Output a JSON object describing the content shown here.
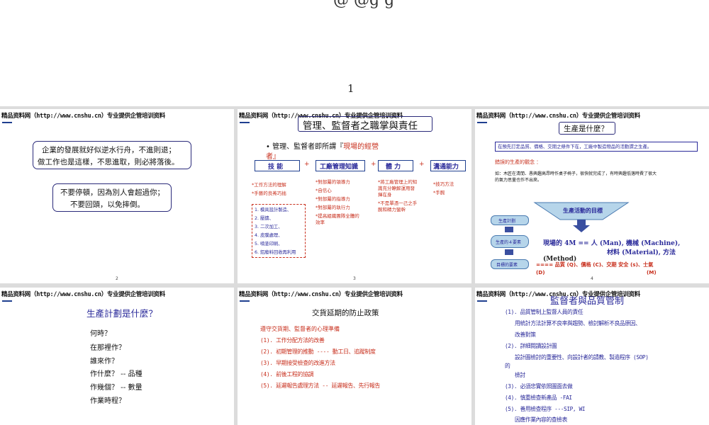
{
  "top_fragment": "@ @g g",
  "page_number": "1",
  "header_text": "精品资料网（http://www.cnshu.cn）专业提供企管培训资料",
  "slide1": {
    "box1": [
      "企業的發展就好似逆水行舟，不進則退；",
      "做工作也是這樣，不思進取，則必將落後。"
    ],
    "box2": [
      "不要停頓，因為別人會超過你；",
      "不要回頭，以免摔倒。"
    ],
    "num": "2"
  },
  "slide2": {
    "title": "管理、監督者之職掌與責任",
    "bullet_a": "• 管理、監督者即所謂『",
    "bullet_b": "現場的經營",
    "bullet_c": "者』",
    "headers": [
      "技 能",
      "+",
      "工廠管理知識",
      "+",
      "體 力",
      "+",
      "溝通能力"
    ],
    "col1_red": [
      "*工作方法的理解",
      "*手藝的良莠巧拙"
    ],
    "col1_list": [
      "1. 模具設計製造、",
      "2. 壓鑄、",
      "3. 二次加工、",
      "4. 皮膜處理、",
      "5. 噴塗印刷、",
      "6. 鋁廢料回收再利用"
    ],
    "col2": [
      "*對部屬的領導力",
      "*自信心",
      "*對部屬的指導力",
      "*對部屬的執行力",
      "*提高組織團隊全體的",
      "效率"
    ],
    "col3": [
      "*將工廠管理上的知",
      "識充分瞭解運用發",
      "揮在身",
      "*不是單憑一己之手",
      "腕和精力蠻幹"
    ],
    "col4": [
      "*技巧方法",
      "*手腕"
    ],
    "num": "3"
  },
  "slide3": {
    "title": "生產是什麼？",
    "definition": "在預先訂定品質、價格、交期之條件下在，工廠中製造物品的活動謂之生產。",
    "wrong_label": "錯誤的生產的觀念 ：",
    "example1": "如：木匠在清閒、愚興趣高昂時作桌子椅子，很快就完成了，有時興趣低落時費了很大",
    "example2": "的氣力思量也作不出來。",
    "funnel": "生產活動的目標",
    "steps": [
      "生產計劃",
      "生產的４要素",
      "目標的要素"
    ],
    "fourm_a": "現場的 4M   == 人 (Man), 機械 (Machine),",
    "fourm_b": "材料 (Material), 方法",
    "fourm_c": "(Method)",
    "qcd_a": "====  品質 (Q)、價格 (C)、交期 安全 (s)、士氣",
    "qcd_b1": "(D)",
    "qcd_b2": "(M)",
    "num": "4"
  },
  "slide4": {
    "title": "生產計劃是什麼？",
    "items": [
      "何時？",
      "在那裡作？",
      "誰來作？",
      "作什麼？ -- 品種",
      "作幾個？ -- 數量",
      "作業時程？"
    ]
  },
  "slide5": {
    "title": "交貨延期的防止政策",
    "subtitle": "遵守交貨期、監督者的心理準備",
    "items": [
      "(1). 工作分配方法的改善",
      "(2). 初期管理的推動  ----  動工日、追蹤制度",
      "(3). 早期接受檢查的改進方法",
      "(4). 前後工程的協調",
      "(5). 延遲報告處理方法  --  延遲報告、先行報告"
    ]
  },
  "slide6": {
    "title": "監督者與品質管制",
    "lines": [
      "(1). 品質管制上監督人員的責任",
      "用統計方法計算不良率與趨勢、檢討解析不良品原因、",
      "改善對策",
      "(2). 詳細閱讀設計圖",
      "設計圖檢討的重要性、向設計者的請教、製造程序 (SOP)",
      "的",
      "檢討",
      "(3). 必須忠實依照圖面去做",
      "(4). 慎重檢查新產品 -FAI",
      "(5). 善用檢查程序 ---SIP, WI",
      "因應作業內容的查檢表"
    ]
  },
  "colors": {
    "accent_blue": "#2a2a9a",
    "accent_red": "#c8301e",
    "navy_box": "#3a4fa0",
    "funnel_fill": "#b6d5ea"
  }
}
